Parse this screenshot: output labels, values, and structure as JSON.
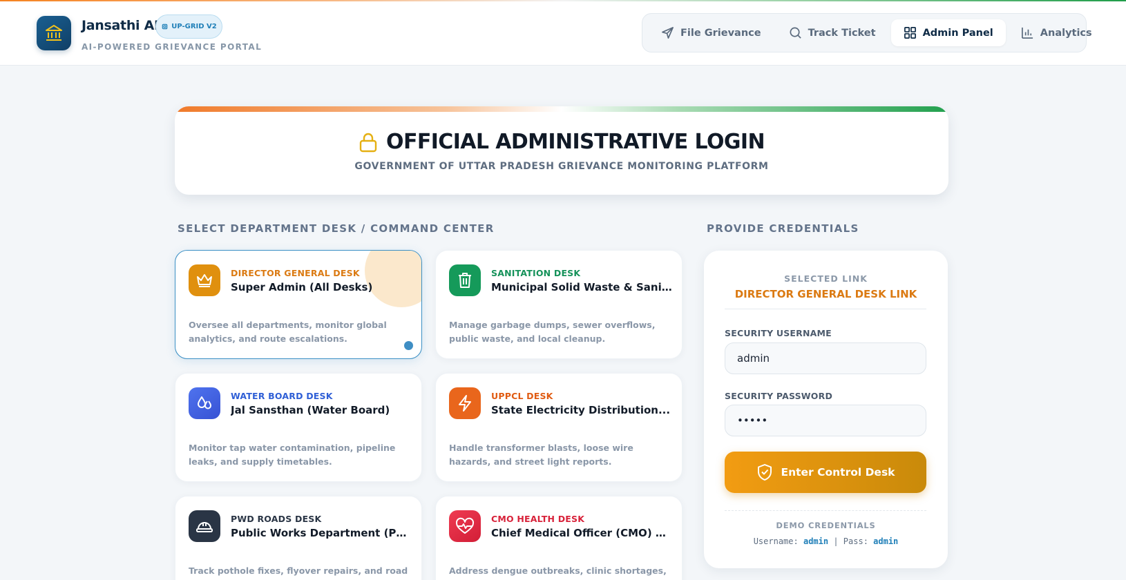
{
  "header": {
    "brand_name": "Jansathi AI",
    "badge": "UP-GRID V2",
    "subtitle": "AI-POWERED GRIEVANCE PORTAL",
    "nav": [
      {
        "label": "File Grievance",
        "icon": "send-icon",
        "active": false
      },
      {
        "label": "Track Ticket",
        "icon": "search-icon",
        "active": false
      },
      {
        "label": "Admin Panel",
        "icon": "grid-icon",
        "active": true
      },
      {
        "label": "Analytics",
        "icon": "bar-chart-icon",
        "active": false
      }
    ]
  },
  "banner": {
    "title": "OFFICIAL ADMINISTRATIVE LOGIN",
    "subtitle": "GOVERNMENT OF UTTAR PRADESH GRIEVANCE MONITORING PLATFORM"
  },
  "desks": {
    "section_label": "SELECT DEPARTMENT DESK / COMMAND CENTER",
    "items": [
      {
        "tag": "DIRECTOR GENERAL DESK",
        "title": "Super Admin (All Desks)",
        "desc": "Oversee all departments, monitor global analytics, and route escalations.",
        "icon": "crown-icon",
        "color": "#e0900e",
        "selected": true
      },
      {
        "tag": "SANITATION DESK",
        "title": "Municipal Solid Waste & Sanitation...",
        "desc": "Manage garbage dumps, sewer overflows, public waste, and local cleanup.",
        "icon": "trash-icon",
        "color": "#159a5a",
        "selected": false
      },
      {
        "tag": "WATER BOARD DESK",
        "title": "Jal Sansthan (Water Board)",
        "desc": "Monitor tap water contamination, pipeline leaks, and supply timetables.",
        "icon": "droplets-icon",
        "color": "#3e63e0",
        "selected": false
      },
      {
        "tag": "UPPCL DESK",
        "title": "State Electricity Distribution...",
        "desc": "Handle transformer blasts, loose wire hazards, and street light reports.",
        "icon": "lightning-icon",
        "color": "#e9661c",
        "selected": false
      },
      {
        "tag": "PWD ROADS DESK",
        "title": "Public Works Department (PWD)",
        "desc": "Track pothole fixes, flyover repairs, and road",
        "icon": "hardhat-icon",
        "color": "#2a3545",
        "selected": false
      },
      {
        "tag": "CMO HEALTH DESK",
        "title": "Chief Medical Officer (CMO) Office",
        "desc": "Address dengue outbreaks, clinic shortages, and",
        "icon": "heart-pulse-icon",
        "color": "#e0283e",
        "selected": false
      }
    ]
  },
  "credentials": {
    "section_label": "PROVIDE CREDENTIALS",
    "selected_label": "SELECTED LINK",
    "selected_value": "DIRECTOR GENERAL DESK LINK",
    "username_label": "SECURITY USERNAME",
    "username_value": "admin",
    "password_label": "SECURITY PASSWORD",
    "password_value": "•••••",
    "submit_label": "Enter Control Desk",
    "demo_label": "DEMO CREDENTIALS",
    "demo_user_label": "Username:",
    "demo_user": "admin",
    "demo_sep": "|",
    "demo_pass_label": "Pass:",
    "demo_pass": "admin"
  },
  "colors": {
    "accent_blue": "#1f7fb8",
    "accent_orange": "#db7a12",
    "saffron": "#f07a2a",
    "green": "#22a04e"
  }
}
